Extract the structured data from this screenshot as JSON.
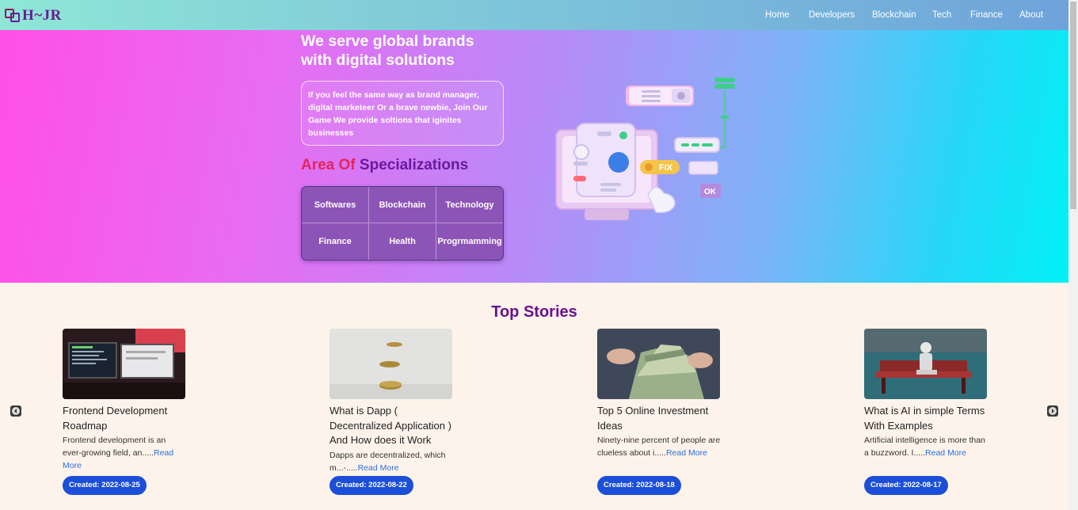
{
  "brand": {
    "name": "H~JR"
  },
  "nav": {
    "items": [
      {
        "label": "Home"
      },
      {
        "label": "Developers"
      },
      {
        "label": "Blockchain"
      },
      {
        "label": "Tech"
      },
      {
        "label": "Finance"
      },
      {
        "label": "About"
      }
    ]
  },
  "hero": {
    "title": "We serve global brands with digital solutions",
    "description": "If you feel the same way as brand manager, digital marketeer Or a brave newbie, Join Our Game We provide soltions that iginites businesses",
    "specializations_title_a": "Area Of",
    "specializations_title_b": "Specializations",
    "specializations": [
      "Softwares",
      "Blockchain",
      "Technology",
      "Finance",
      "Health",
      "Progrmamming"
    ],
    "illustration": {
      "fix_label": "FIX",
      "ok_label": "OK"
    }
  },
  "stories": {
    "title": "Top Stories",
    "read_more": "Read More",
    "items": [
      {
        "title": "Frontend Development Roadmap",
        "excerpt": "Frontend development is an ever-growing field, an.....",
        "created": "Created: 2022-08-25"
      },
      {
        "title": "What is Dapp ( Decentralized Application ) And How does it Work",
        "excerpt": "Dapps are decentralized, which m...-.....",
        "created": "Created: 2022-08-22"
      },
      {
        "title": "Top 5 Online Investment Ideas",
        "excerpt": "Ninety-nine percent of people are clueless about i.....",
        "created": "Created: 2022-08-18"
      },
      {
        "title": "What is AI in simple Terms With Examples",
        "excerpt": "Artificial intelligence is more than a buzzword. I.....",
        "created": "Created: 2022-08-17"
      }
    ]
  },
  "colors": {
    "accent_purple": "#6a1090",
    "accent_red": "#e5255c",
    "badge_blue": "#1c4fd8",
    "link_blue": "#2a6fe0"
  }
}
